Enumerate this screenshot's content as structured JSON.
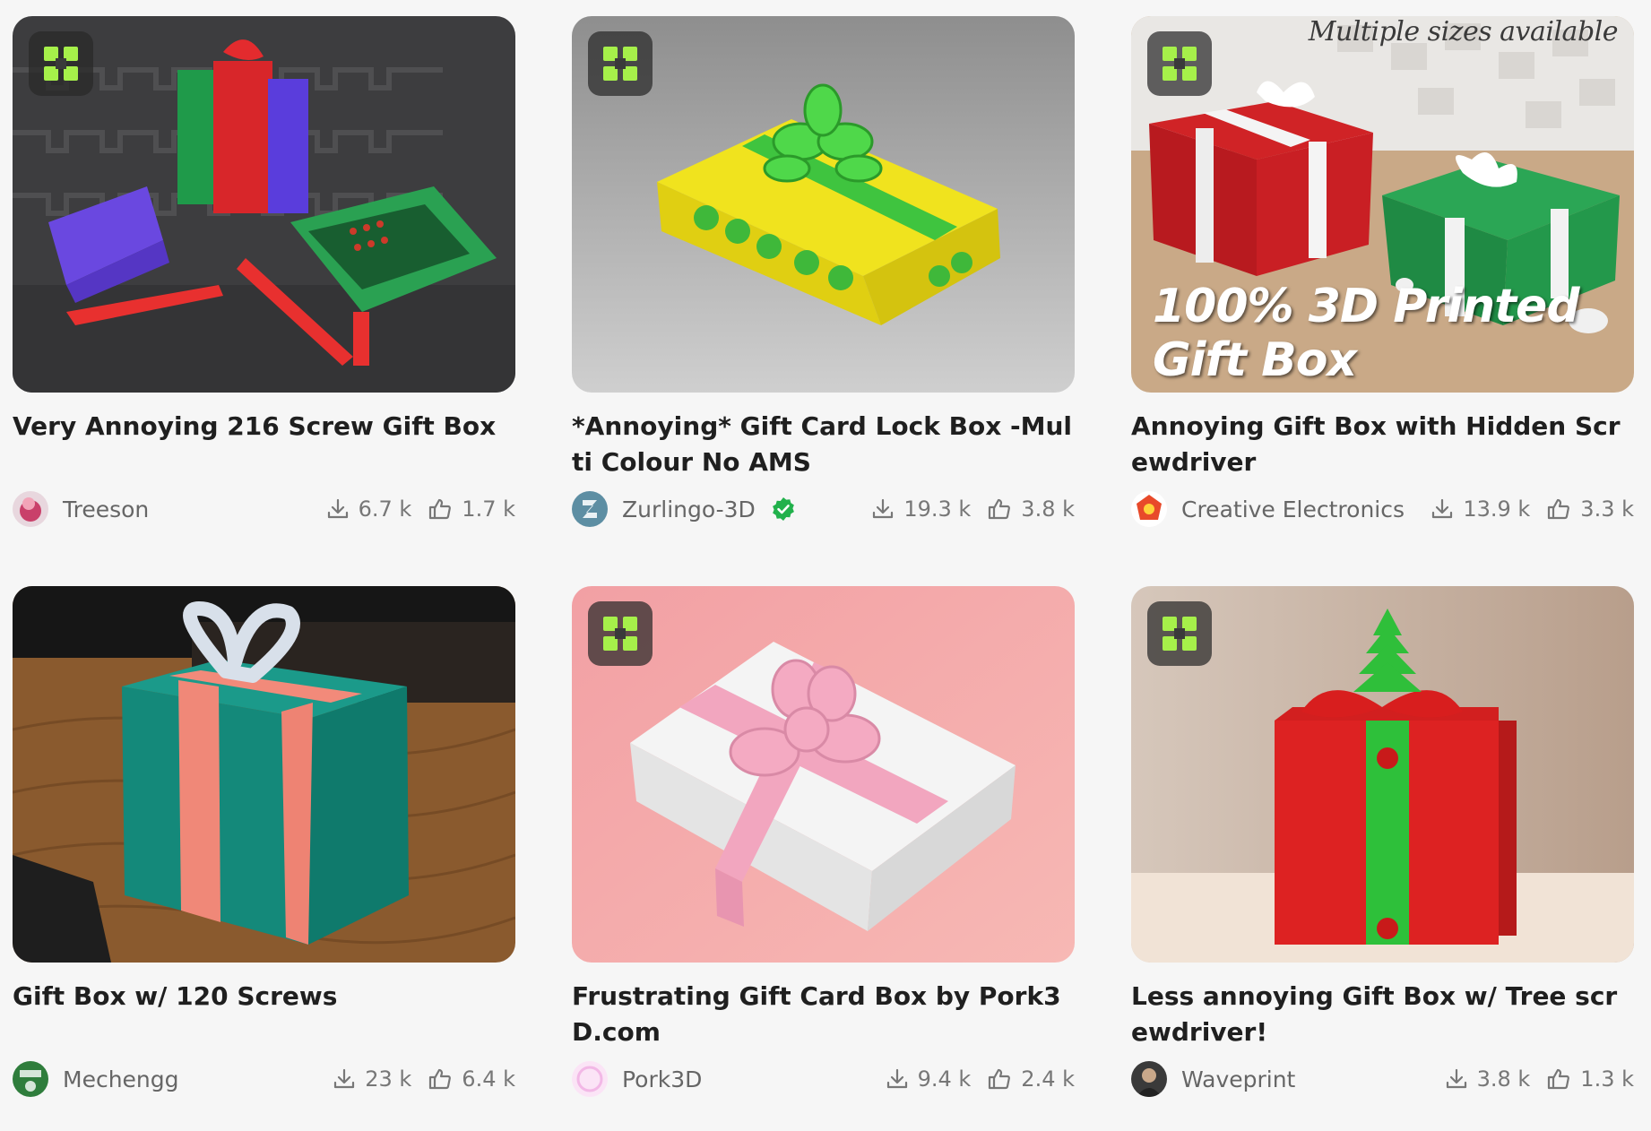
{
  "cards": [
    {
      "title": "Very Annoying 216 Screw Gift Box",
      "author": "Treeson",
      "downloads": "6.7 k",
      "likes": "1.7 k",
      "verified": false,
      "badge": true
    },
    {
      "title": "*Annoying* Gift Card Lock Box -Multi Colour No AMS",
      "author": "Zurlingo-3D",
      "downloads": "19.3 k",
      "likes": "3.8 k",
      "verified": true,
      "badge": true
    },
    {
      "title": "Annoying Gift Box with Hidden Screwdriver",
      "author": "Creative Electronics",
      "downloads": "13.9 k",
      "likes": "3.3 k",
      "verified": false,
      "badge": true,
      "image_caption": "Multiple sizes available",
      "image_banner": "100% 3D Printed Gift Box"
    },
    {
      "title": "Gift Box w/ 120 Screws",
      "author": "Mechengg",
      "downloads": "23 k",
      "likes": "6.4 k",
      "verified": false,
      "badge": false
    },
    {
      "title": "Frustrating Gift Card Box by Pork3D.com",
      "author": "Pork3D",
      "downloads": "9.4 k",
      "likes": "2.4 k",
      "verified": false,
      "badge": true
    },
    {
      "title": "Less annoying Gift Box w/ Tree screwdriver!",
      "author": "Waveprint",
      "downloads": "3.8 k",
      "likes": "1.3 k",
      "verified": false,
      "badge": true
    }
  ],
  "icons": {
    "badge": "maker-cube-icon",
    "downloads": "download-icon",
    "likes": "thumbs-up-icon",
    "verified": "verified-check-icon"
  },
  "colors": {
    "background": "#f6f6f6",
    "badge_green": "#a6f04a",
    "verified_green": "#22b14c",
    "meta_gray": "#777777"
  }
}
